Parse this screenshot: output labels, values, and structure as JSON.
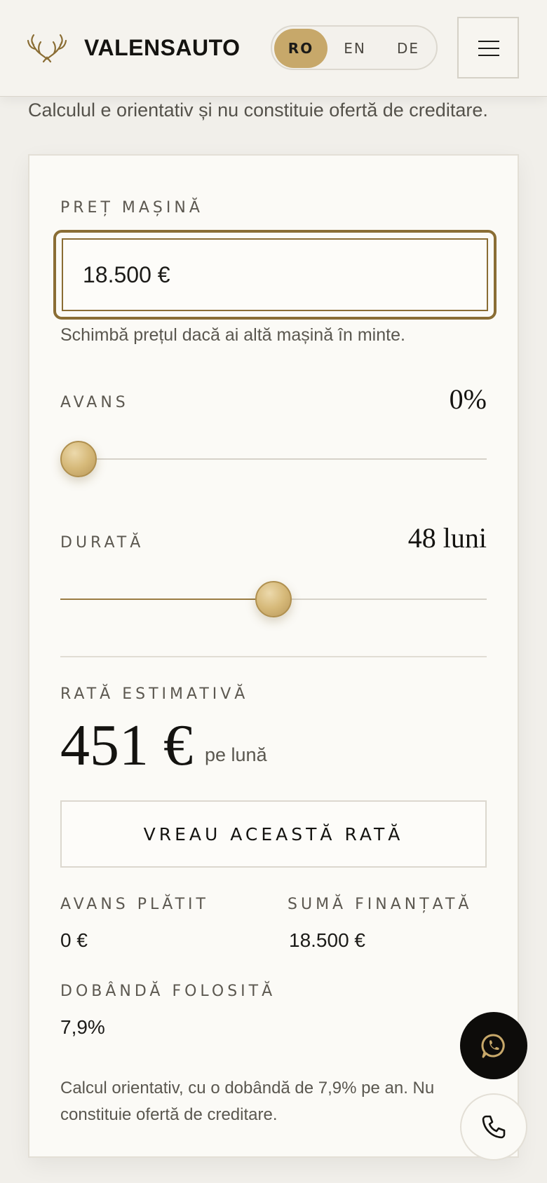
{
  "header": {
    "brand": "VALENSAUTO",
    "languages": [
      {
        "code": "RO",
        "active": true
      },
      {
        "code": "EN",
        "active": false
      },
      {
        "code": "DE",
        "active": false
      }
    ],
    "menu_icon": "hamburger-menu-icon",
    "logo_icon": "antlers-laurel-icon"
  },
  "intro_note": "Calculul e orientativ și nu constituie ofertă de creditare.",
  "calculator": {
    "price": {
      "label": "PREȚ MAȘINĂ",
      "value": "18.500 €",
      "hint": "Schimbă prețul dacă ai altă mașină în minte."
    },
    "down_payment": {
      "label": "AVANS",
      "display": "0%",
      "slider_fraction": 0
    },
    "duration": {
      "label": "DURATĂ",
      "display": "48 luni",
      "slider_fraction": 0.5
    },
    "rate": {
      "label": "RATĂ ESTIMATIVĂ",
      "value": "451 €",
      "unit": "pe lună"
    },
    "cta_label": "VREAU ACEASTĂ RATĂ",
    "stats": [
      {
        "label": "AVANS PLĂTIT",
        "value": "0 €"
      },
      {
        "label": "SUMĂ FINANȚATĂ",
        "value": "18.500 €"
      },
      {
        "label": "DOBÂNDĂ FOLOSITĂ",
        "value": "7,9%"
      }
    ],
    "footnote": "Calcul orientativ, cu o dobândă de 7,9% pe an. Nu constituie ofertă de creditare."
  },
  "floating_actions": {
    "whatsapp_icon": "whatsapp-icon",
    "phone_icon": "phone-icon"
  },
  "colors": {
    "accent_gold": "#c7a86a",
    "border_gold": "#8a6d34",
    "background": "#f1efea",
    "card": "#fbfaf6",
    "text_dark": "#141310"
  }
}
